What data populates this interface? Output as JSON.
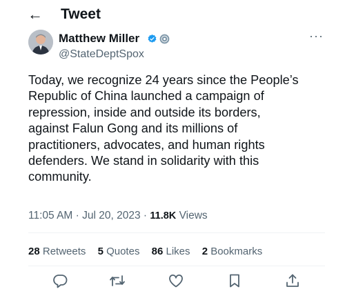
{
  "header": {
    "title": "Tweet"
  },
  "author": {
    "name": "Matthew Miller",
    "handle": "@StateDeptSpox"
  },
  "tweet": {
    "lines": [
      "Today, we recognize 24 years since the People’s",
      "Republic of China launched a campaign of",
      "repression, inside and outside its borders,",
      "against Falun Gong and its millions of",
      "practitioners, advocates, and human rights",
      "defenders. We stand in solidarity with this",
      "community."
    ],
    "time": "11:05 AM",
    "date": "Jul 20, 2023",
    "views_count": "11.8K",
    "views_label": "Views"
  },
  "stats": {
    "retweets_count": "28",
    "retweets_label": "Retweets",
    "quotes_count": "5",
    "quotes_label": "Quotes",
    "likes_count": "86",
    "likes_label": "Likes",
    "bookmarks_count": "2",
    "bookmarks_label": "Bookmarks"
  },
  "colors": {
    "text": "#0f1419",
    "secondary": "#536471",
    "verified": "#1d9bf0",
    "gov_badge": "#829aab"
  },
  "icons": [
    "back-arrow-icon",
    "verified-icon",
    "government-badge-icon",
    "more-icon",
    "reply-icon",
    "retweet-icon",
    "like-icon",
    "bookmark-icon",
    "share-icon"
  ]
}
